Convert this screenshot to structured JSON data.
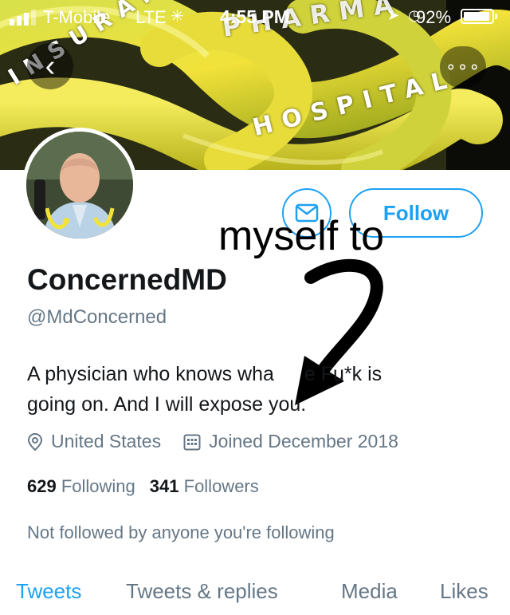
{
  "status_bar": {
    "carrier": "T-Mobile",
    "network": "LTE",
    "time": "4:55 PM",
    "battery": "92%"
  },
  "banner": {
    "overlay_words": {
      "insurance": "INSURANCE",
      "pharma": "PHARMA",
      "hospital": "HOSPITAL"
    }
  },
  "nav": {
    "back_glyph": "‹",
    "more_glyph": "∘∘∘"
  },
  "actions": {
    "follow_label": "Follow"
  },
  "annotation": {
    "text": "myself to"
  },
  "profile": {
    "display_name": "ConcernedMD",
    "handle": "@MdConcerned",
    "bio_line1": "A physician who knows wha",
    "bio_line1_tail": "e Fu*k is",
    "bio_line2": "going on. And I will expose you.",
    "location": "United States",
    "joined": "Joined December 2018",
    "following_count": "629",
    "following_label": "Following",
    "followers_count": "341",
    "followers_label": "Followers",
    "not_followed": "Not followed by anyone you're following"
  },
  "tabs": [
    {
      "label": "Tweets",
      "active": true
    },
    {
      "label": "Tweets & replies",
      "active": false
    },
    {
      "label": "Media",
      "active": false
    },
    {
      "label": "Likes",
      "active": false
    }
  ],
  "colors": {
    "accent": "#1da1f2",
    "secondary_text": "#657786",
    "primary_text": "#14171a"
  }
}
